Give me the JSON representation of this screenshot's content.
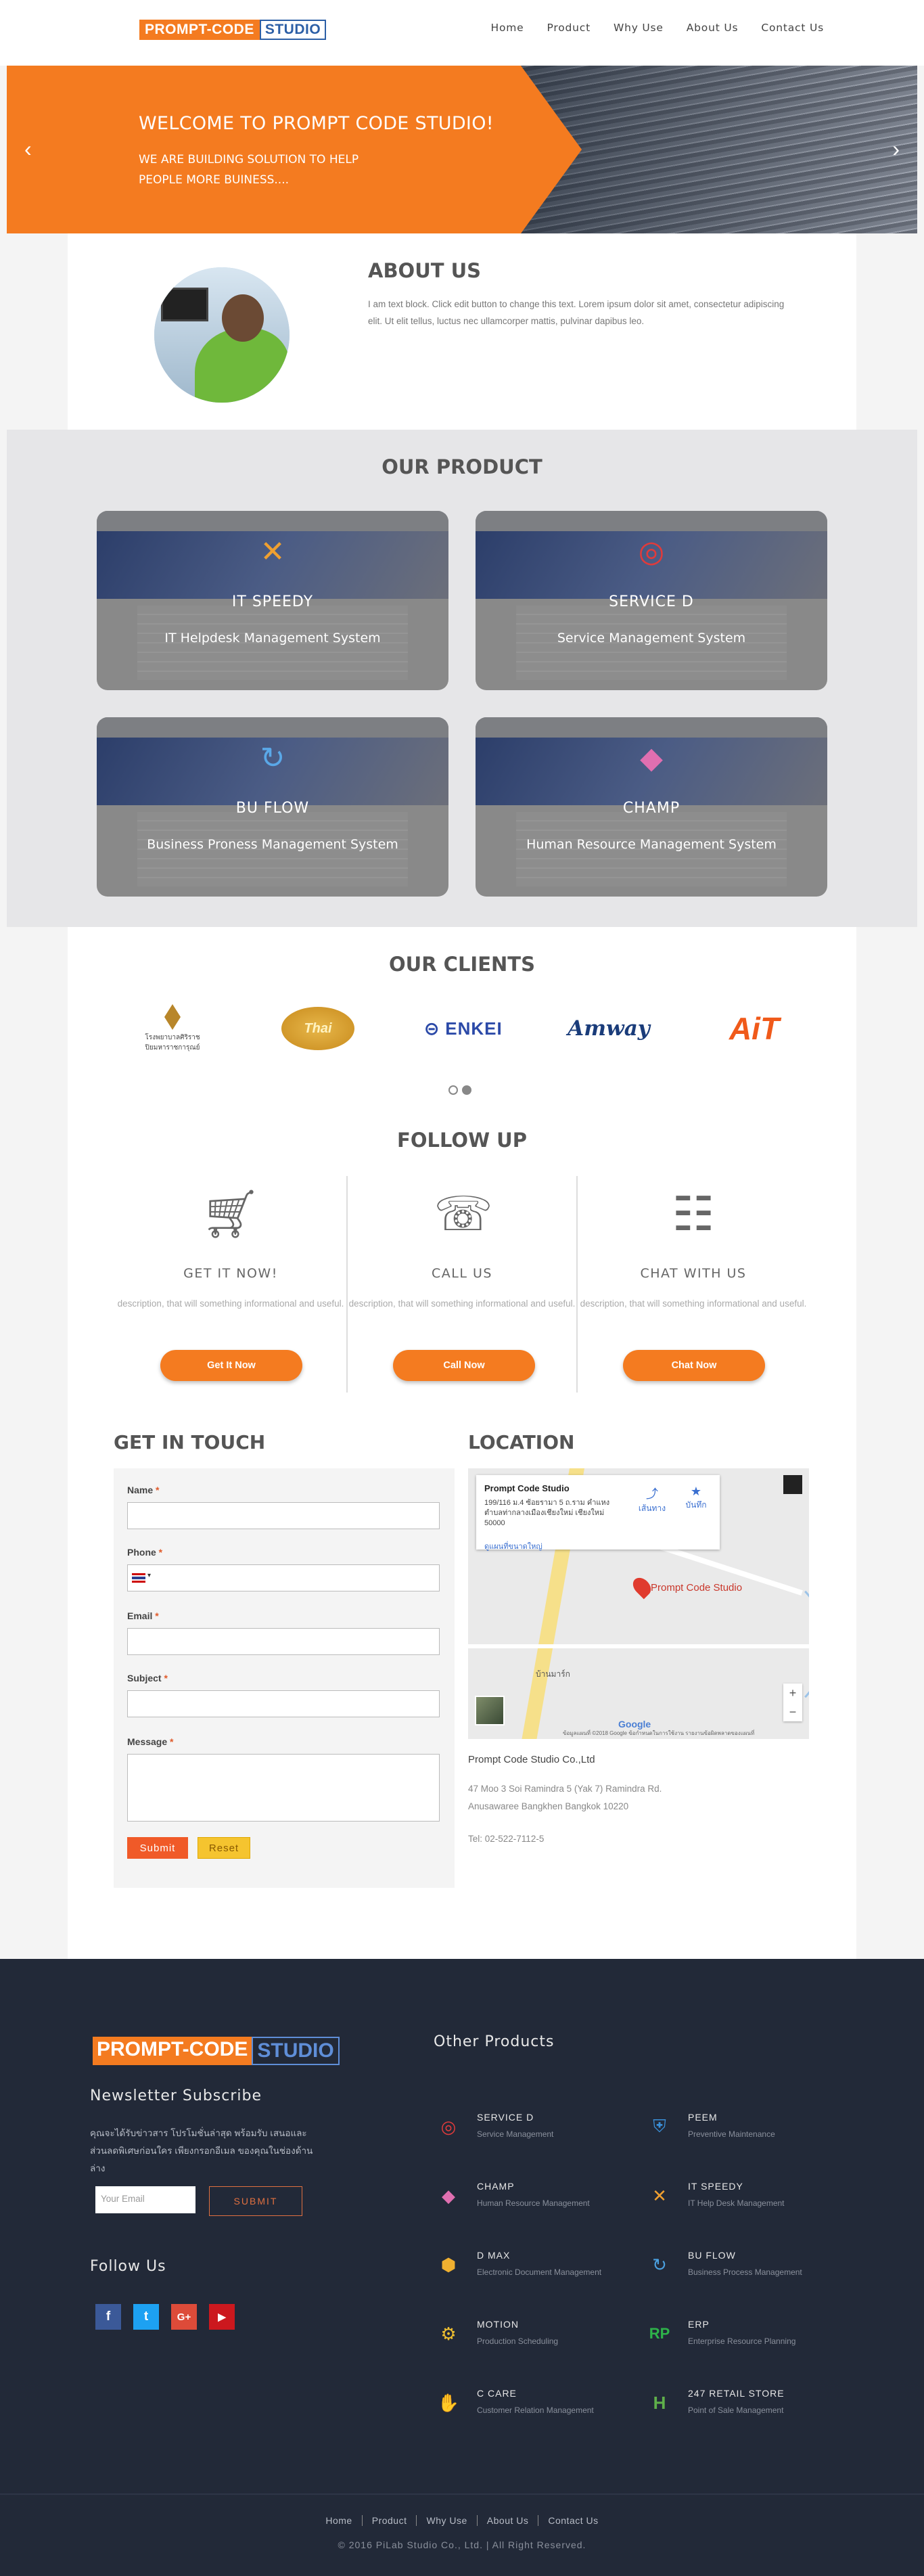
{
  "nav": {
    "logo_part1": "PROMPT-CODE",
    "logo_part2": "STUDIO",
    "items": [
      "Home",
      "Product",
      "Why Use",
      "About Us",
      "Contact Us"
    ]
  },
  "hero": {
    "title": "WELCOME TO PROMPT CODE STUDIO!",
    "subtitle_line1": "WE ARE BUILDING SOLUTION TO HELP",
    "subtitle_line2": "PEOPLE MORE BUINESS....",
    "prev_icon": "chevron-left-icon",
    "next_icon": "chevron-right-icon"
  },
  "about": {
    "title": "ABOUT US",
    "text": "I am text block. Click edit button to change this text. Lorem ipsum dolor sit amet, consectetur adipiscing elit. Ut elit tellus, luctus nec ullamcorper mattis, pulvinar dapibus leo."
  },
  "product": {
    "title": "OUR PRODUCT",
    "items": [
      {
        "name": "IT SPEEDY",
        "desc": "IT Helpdesk Management System",
        "icon": "tools-icon"
      },
      {
        "name": "SERVICE D",
        "desc": "Service Management System",
        "icon": "target-icon"
      },
      {
        "name": "BU FLOW",
        "desc": "Business Proness Management System",
        "icon": "refresh-icon"
      },
      {
        "name": "CHAMP",
        "desc": "Human Resource Management System",
        "icon": "cubes-icon"
      }
    ]
  },
  "clients": {
    "title": "OUR CLIENTS",
    "gov_line1": "โรงพยาบาลศิริราช",
    "gov_line2": "ปิยมหาราชการุณย์",
    "gold_text": "Thai",
    "enkei": "ENKEI",
    "amway": "Amway",
    "ait": "AiT"
  },
  "follow": {
    "title": "FOLLOW UP",
    "cols": [
      {
        "title": "GET IT NOW!",
        "desc": "description, that will something informational and useful.",
        "button": "Get It Now",
        "icon": "cart-icon"
      },
      {
        "title": "CALL US",
        "desc": "description, that will something informational and useful.",
        "button": "Call Now",
        "icon": "phone-icon"
      },
      {
        "title": "CHAT WITH US",
        "desc": "description, that will something informational and useful.",
        "button": "Chat Now",
        "icon": "chat-icon"
      }
    ]
  },
  "contact": {
    "title": "GET IN TOUCH",
    "fields": {
      "name": "Name",
      "phone": "Phone",
      "email": "Email",
      "subject": "Subject",
      "message": "Message"
    },
    "required_mark": "*",
    "submit": "Submit",
    "reset": "Reset"
  },
  "location": {
    "title": "LOCATION",
    "map_title": "Prompt Code Studio",
    "map_address": "199/116 ม.4 ซ้อยรามา 5 ถ.ราม คำแหง ตำบลท่ากลางเมืองเชียงใหม่ เชียงใหม่ 50000",
    "map_link": "ดูแผนที่ขนาดใหญ่",
    "map_directions": "เส้นทาง",
    "map_save": "บันทึก",
    "pin_label": "Prompt Code Studio",
    "road_label": "บ้านมาร์ก",
    "map_footer": "ข้อมูลแผนที่ ©2018 Google  ข้อกำหนดในการใช้งาน  รายงานข้อผิดพลาดของแผนที่",
    "google": "Google",
    "company": "Prompt Code Studio Co.,Ltd",
    "addr1": "47 Moo 3 Soi Ramindra 5 (Yak 7) Ramindra Rd.",
    "addr2": "Anusawaree Bangkhen Bangkok 10220",
    "tel": "Tel: 02-522-7112-5"
  },
  "footer": {
    "logo_part1": "PROMPT-CODE",
    "logo_part2": "STUDIO",
    "newsletter_title": "Newsletter Subscribe",
    "newsletter_text": "คุณจะได้รับข่าวสาร โปรโมชั่นล่าสุด พร้อมรับ เสนอและส่วนลดพิเศษก่อนใคร เพียงกรอกอีเมล ของคุณในช่องด้านล่าง",
    "email_placeholder": "Your Email",
    "submit": "SUBMIT",
    "follow_title": "Follow Us",
    "social": [
      {
        "icon": "facebook-icon",
        "glyph": "f",
        "color": "#3b5998"
      },
      {
        "icon": "twitter-icon",
        "glyph": "t",
        "color": "#1da1f2"
      },
      {
        "icon": "google-plus-icon",
        "glyph": "G+",
        "color": "#dd4b39"
      },
      {
        "icon": "youtube-icon",
        "glyph": "▶",
        "color": "#cc181e"
      }
    ],
    "other_title": "Other Products",
    "products": [
      {
        "name": "SERVICE D",
        "desc": "Service Management",
        "icon": "target-icon",
        "glyph": "◎",
        "color": "#e03b3b"
      },
      {
        "name": "PEEM",
        "desc": "Preventive Maintenance",
        "icon": "shield-icon",
        "glyph": "⛨",
        "color": "#3a8fd8"
      },
      {
        "name": "CHAMP",
        "desc": "Human Resource Management",
        "icon": "cubes-icon",
        "glyph": "◆",
        "color": "#e06fb0"
      },
      {
        "name": "IT SPEEDY",
        "desc": "IT Help Desk Management",
        "icon": "tools-icon",
        "glyph": "✕",
        "color": "#f0a030"
      },
      {
        "name": "D MAX",
        "desc": "Electronic Document Management",
        "icon": "hexagon-icon",
        "glyph": "⬢",
        "color": "#f0b030"
      },
      {
        "name": "BU FLOW",
        "desc": "Business Process Management",
        "icon": "refresh-icon",
        "glyph": "↻",
        "color": "#4aa0e0"
      },
      {
        "name": "MOTION",
        "desc": "Production Scheduling",
        "icon": "gears-icon",
        "glyph": "⚙",
        "color": "#f0c030"
      },
      {
        "name": "ERP",
        "desc": "Enterprise Resource Planning",
        "icon": "rp-icon",
        "glyph": "RP",
        "color": "#2eb34a"
      },
      {
        "name": "C CARE",
        "desc": "Customer Relation Management",
        "icon": "handshake-icon",
        "glyph": "✋",
        "color": "#f0a030"
      },
      {
        "name": "247 RETAIL STORE",
        "desc": "Point of Sale Management",
        "icon": "hero-icon",
        "glyph": "H",
        "color": "#5fb04a"
      }
    ],
    "menu": [
      "Home",
      "Product",
      "Why Use",
      "About Us",
      "Contact Us"
    ],
    "copyright": "© 2016 PiLab Studio Co., Ltd.  |  All Right Reserved."
  }
}
